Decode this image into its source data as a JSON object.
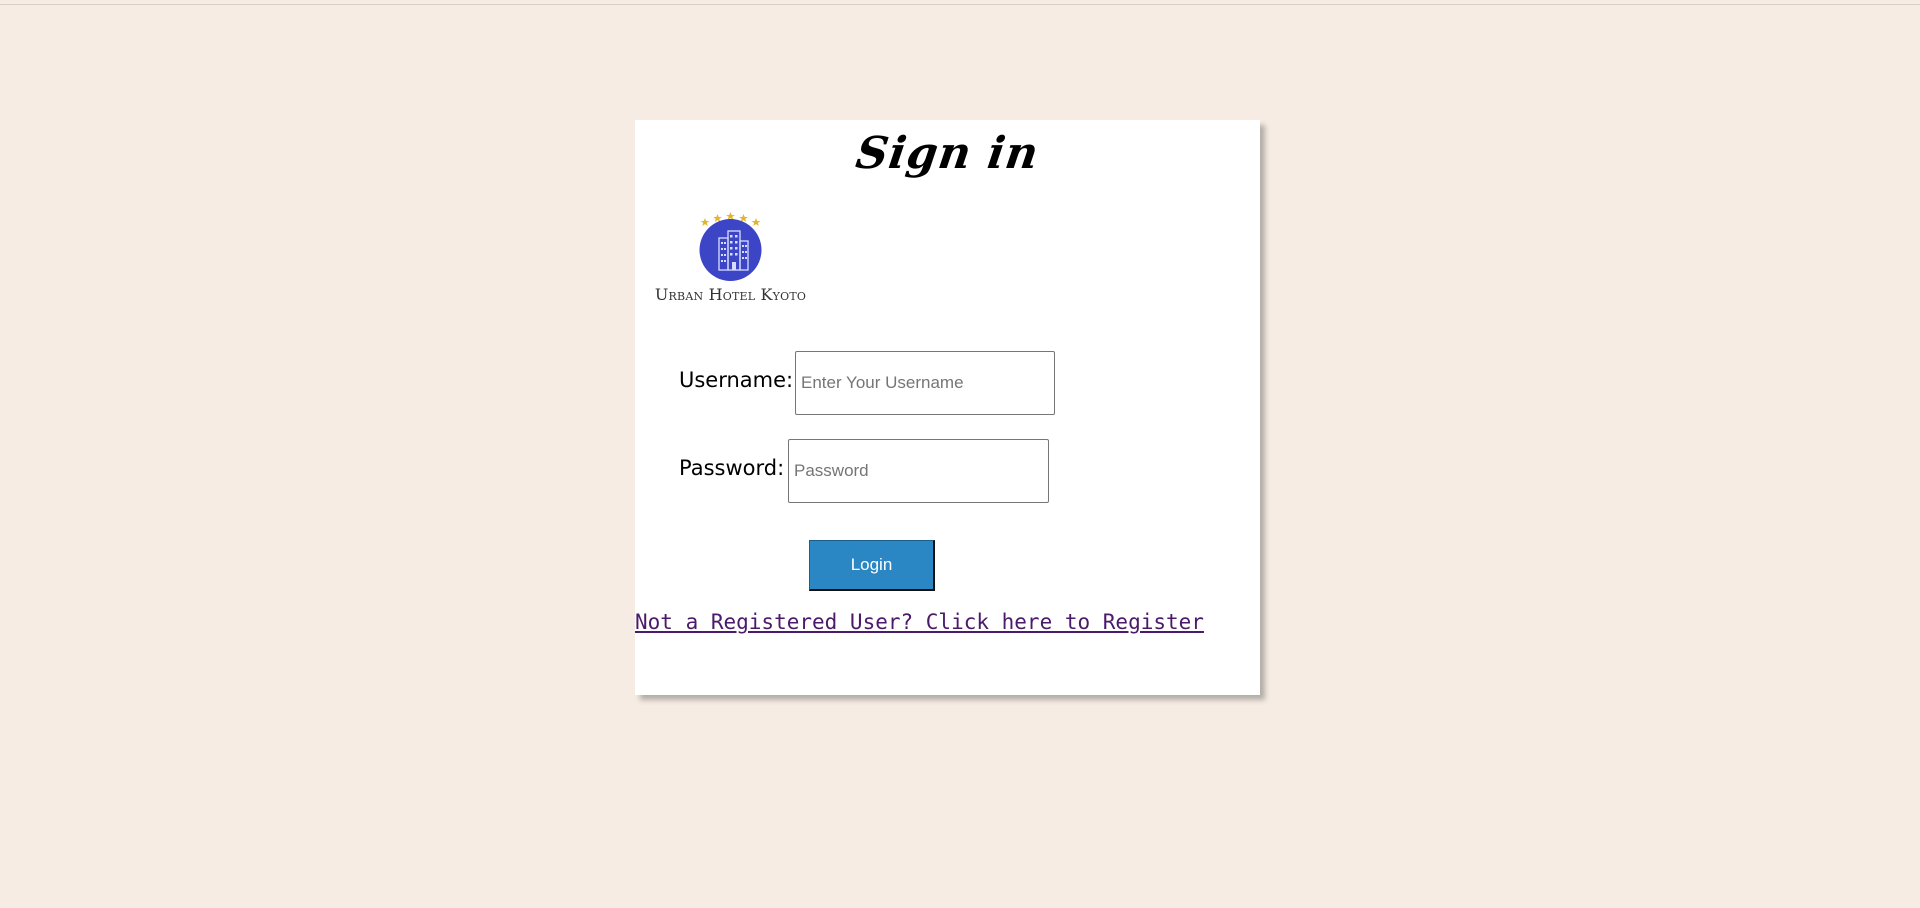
{
  "page": {
    "background": "#f6ece3"
  },
  "signin": {
    "title": "Sign in",
    "logo": {
      "brand_text": "Urban Hotel Kyoto",
      "icon": "hotel-building-icon",
      "star_count": 5,
      "circle_color": "#3b45c6",
      "star_color": "#e2b62b"
    },
    "username": {
      "label": "Username:",
      "placeholder": "Enter Your Username",
      "value": ""
    },
    "password": {
      "label": "Password:",
      "placeholder": "Password",
      "value": ""
    },
    "login_label": "Login",
    "login_color": "#2a87c4",
    "register_link": "Not a Registered User? Click here to Register"
  }
}
